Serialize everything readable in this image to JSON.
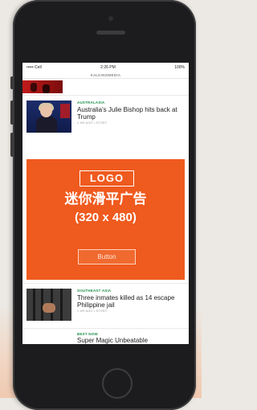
{
  "status": {
    "left": "••••• Cell",
    "time": "2:26 PM",
    "right": "100%"
  },
  "app": {
    "brand": "KALKINGMEDIA"
  },
  "articles": [
    {
      "category": "AUSTRALASIA",
      "title": "Australia's Julie Bishop hits back at Trump",
      "meta": "1 HR AGO • STORY"
    },
    {
      "category": "SOUTHEAST ASIA",
      "title": "Three inmates killed as 14 escape Philippine jail",
      "meta": "1 HR AGO • STORY"
    },
    {
      "category": "BEST NOW",
      "title": "Super Magic Unbeatable"
    }
  ],
  "ad": {
    "logo": "LOGO",
    "headline": "迷你滑平广告",
    "size": "(320 x 480)",
    "button_label": "Button"
  },
  "colors": {
    "ad_bg": "#ef5a1e",
    "category": "#1f8f4a",
    "phone": "#1c1c1e"
  }
}
